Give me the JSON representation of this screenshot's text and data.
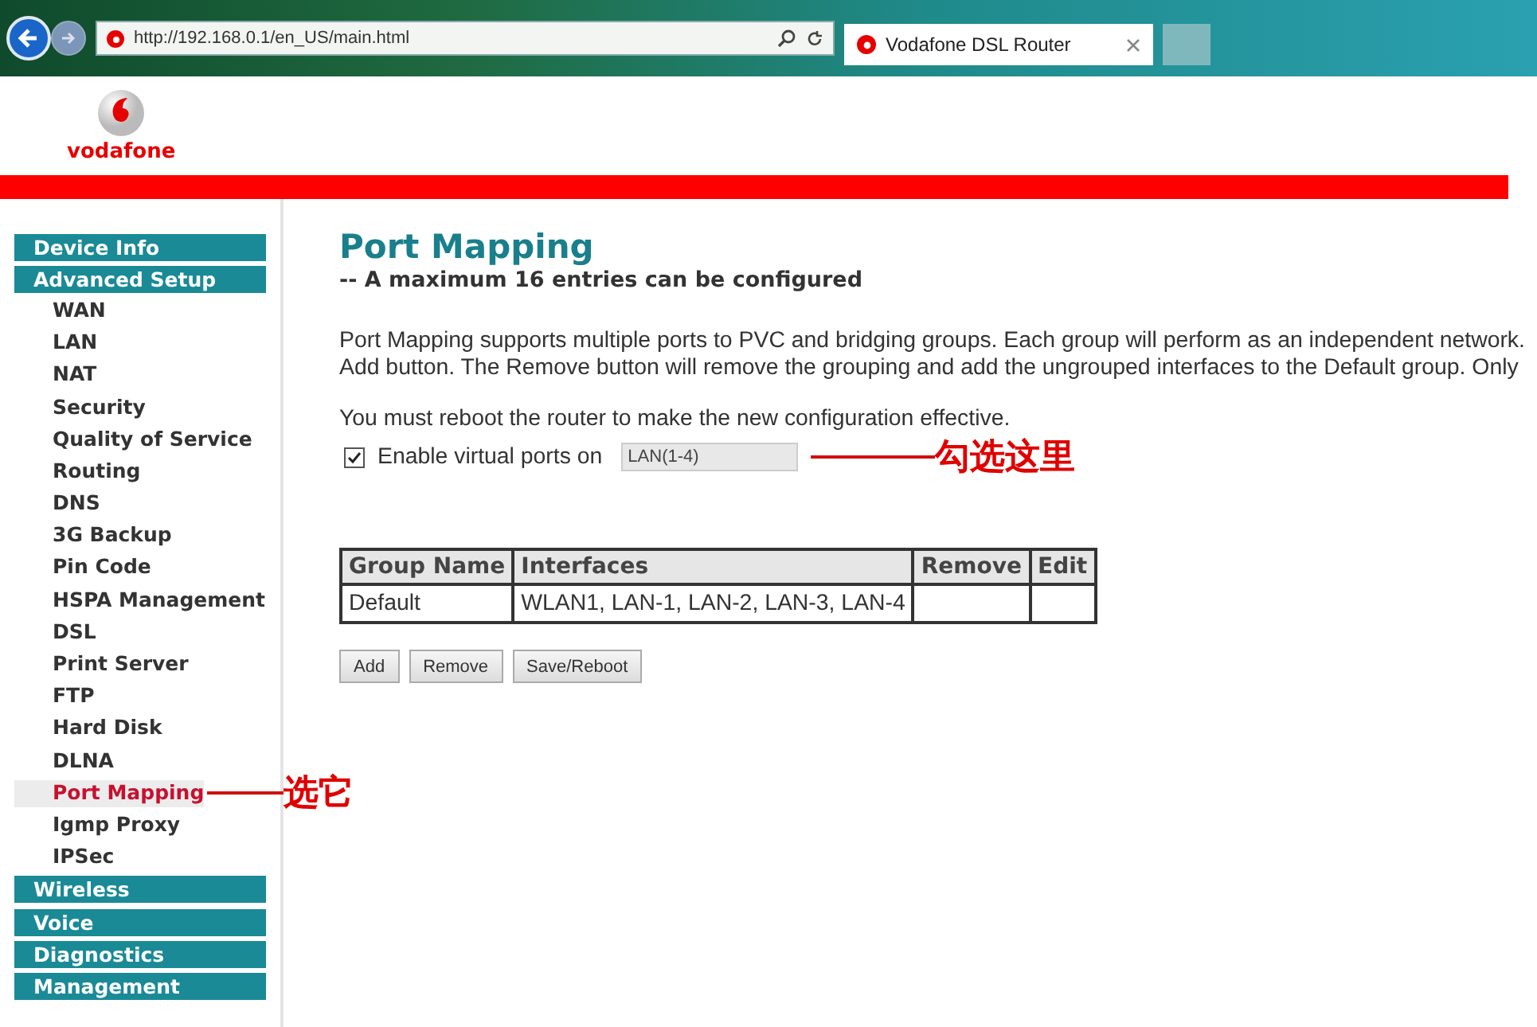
{
  "browser": {
    "address": "http://192.168.0.1/en_US/main.html",
    "tab_title": "Vodafone DSL Router"
  },
  "logo": {
    "text": "vodafone"
  },
  "nav": [
    {
      "label": "Device Info",
      "kind": "group",
      "selected": false
    },
    {
      "label": "Advanced Setup",
      "kind": "group",
      "selected": false
    },
    {
      "label": "WAN",
      "kind": "sub",
      "selected": false
    },
    {
      "label": "LAN",
      "kind": "sub",
      "selected": false
    },
    {
      "label": "NAT",
      "kind": "sub",
      "selected": false
    },
    {
      "label": "Security",
      "kind": "sub",
      "selected": false
    },
    {
      "label": "Quality of Service",
      "kind": "sub",
      "selected": false
    },
    {
      "label": "Routing",
      "kind": "sub",
      "selected": false
    },
    {
      "label": "DNS",
      "kind": "sub",
      "selected": false
    },
    {
      "label": "3G Backup",
      "kind": "sub",
      "selected": false
    },
    {
      "label": "Pin Code",
      "kind": "sub",
      "selected": false
    },
    {
      "label": "HSPA Management",
      "kind": "sub",
      "selected": false
    },
    {
      "label": "DSL",
      "kind": "sub",
      "selected": false
    },
    {
      "label": "Print Server",
      "kind": "sub",
      "selected": false
    },
    {
      "label": "FTP",
      "kind": "sub",
      "selected": false
    },
    {
      "label": "Hard Disk",
      "kind": "sub",
      "selected": false
    },
    {
      "label": "DLNA",
      "kind": "sub",
      "selected": false
    },
    {
      "label": "Port Mapping",
      "kind": "sub",
      "selected": true,
      "annotation": "选它"
    },
    {
      "label": "Igmp Proxy",
      "kind": "sub",
      "selected": false
    },
    {
      "label": "IPSec",
      "kind": "sub",
      "selected": false
    },
    {
      "label": "Wireless",
      "kind": "group",
      "selected": false
    },
    {
      "label": "Voice",
      "kind": "group",
      "selected": false
    },
    {
      "label": "Diagnostics",
      "kind": "group",
      "selected": false
    },
    {
      "label": "Management",
      "kind": "group",
      "selected": false
    }
  ],
  "content": {
    "title": "Port Mapping",
    "subtitle": "-- A maximum 16 entries can be configured",
    "description": [
      "Port Mapping supports multiple ports to PVC and bridging groups. Each group will perform as an independent network.",
      "Add button. The Remove button will remove the grouping and add the ungrouped interfaces to the Default group. Only"
    ],
    "note": "You must reboot the router to make the new configuration effective.",
    "virtual_ports": {
      "checked": true,
      "label": "Enable virtual ports on",
      "value": "LAN(1-4)",
      "annotation": "勾选这里"
    },
    "table": {
      "columns": [
        "Group Name",
        "Interfaces",
        "Remove",
        "Edit"
      ],
      "rows": [
        [
          "Default",
          "WLAN1, LAN-1, LAN-2, LAN-3, LAN-4",
          "",
          ""
        ]
      ]
    },
    "buttons": [
      "Add",
      "Remove",
      "Save/Reboot"
    ]
  }
}
